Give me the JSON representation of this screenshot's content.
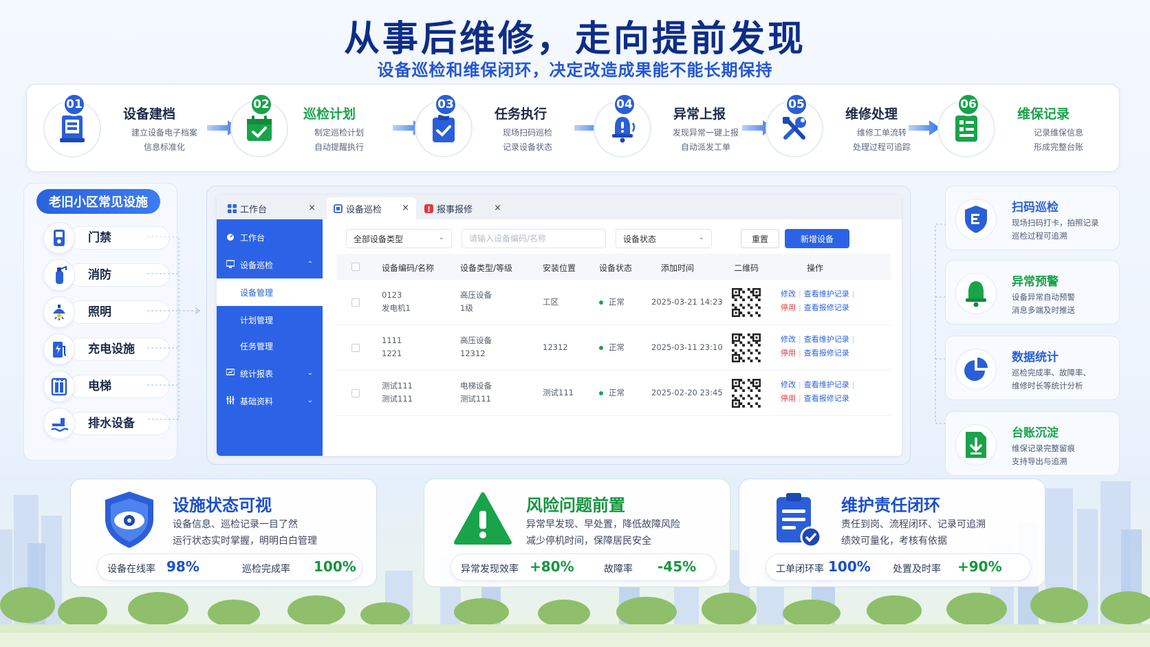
{
  "hero": {
    "title": "从事后维修，走向提前发现",
    "subtitle": "设备巡检和维保闭环，决定改造成果能不能长期保持"
  },
  "steps": [
    {
      "num": "01",
      "title": "设备建档",
      "desc1": "建立设备电子档案",
      "desc2": "信息标准化",
      "color": "#2a5fd8",
      "icon": "device-file-icon"
    },
    {
      "num": "02",
      "title": "巡检计划",
      "desc1": "制定巡检计划",
      "desc2": "自动提醒执行",
      "color": "#19a34a",
      "icon": "calendar-check-icon"
    },
    {
      "num": "03",
      "title": "任务执行",
      "desc1": "现场扫码巡检",
      "desc2": "记录设备状态",
      "color": "#2a5fd8",
      "icon": "clipboard-check-icon"
    },
    {
      "num": "04",
      "title": "异常上报",
      "desc1": "发现异常一键上报",
      "desc2": "自动派发工单",
      "color": "#2a5fd8",
      "icon": "alarm-bell-icon"
    },
    {
      "num": "05",
      "title": "维修处理",
      "desc1": "维修工单流转",
      "desc2": "处理过程可追踪",
      "color": "#2a5fd8",
      "icon": "repair-tools-icon"
    },
    {
      "num": "06",
      "title": "维保记录",
      "desc1": "记录维保信息",
      "desc2": "形成完整台账",
      "color": "#19a34a",
      "icon": "record-book-icon"
    }
  ],
  "facilities": {
    "heading": "老旧小区常见设施",
    "items": [
      {
        "label": "门禁",
        "icon": "access-control-icon"
      },
      {
        "label": "消防",
        "icon": "fire-extinguisher-icon"
      },
      {
        "label": "照明",
        "icon": "lighting-icon"
      },
      {
        "label": "充电设施",
        "icon": "charging-station-icon"
      },
      {
        "label": "电梯",
        "icon": "elevator-icon"
      },
      {
        "label": "排水设备",
        "icon": "drainage-icon"
      }
    ]
  },
  "app": {
    "tabs": [
      {
        "label": "工作台",
        "close": "×"
      },
      {
        "label": "设备巡检",
        "close": "×"
      },
      {
        "label": "报事报修",
        "close": "×"
      }
    ],
    "nav": {
      "workbench": "工作台",
      "inspection": "设备巡检",
      "device_mgmt": "设备管理",
      "plan_mgmt": "计划管理",
      "task_mgmt": "任务管理",
      "reports": "统计报表",
      "basic_data": "基础资料"
    },
    "filters": {
      "type_select": "全部设备类型",
      "search_placeholder": "请输入设备编码/名称",
      "status_select": "设备状态",
      "reset": "重置",
      "add": "新增设备"
    },
    "columns": [
      "设备编码/名称",
      "设备类型/等级",
      "安装位置",
      "设备状态",
      "添加时间",
      "二维码",
      "操作"
    ],
    "rows": [
      {
        "code": "0123",
        "name": "发电机1",
        "type": "高压设备",
        "level": "1级",
        "location": "工区",
        "status": "正常",
        "time": "2025-03-21 14:23"
      },
      {
        "code": "1111",
        "name": "1221",
        "type": "高压设备",
        "level": "12312",
        "location": "12312",
        "status": "正常",
        "time": "2025-03-11 23:10"
      },
      {
        "code": "测试111",
        "name": "测试111",
        "type": "电梯设备",
        "level": "测试111",
        "location": "测试111",
        "status": "正常",
        "time": "2025-02-20 23:45"
      }
    ],
    "ops": {
      "edit": "修改",
      "maint_record": "查看维护记录",
      "disable": "停用",
      "repair_record": "查看报修记录",
      "sep": "|"
    }
  },
  "features": [
    {
      "title": "扫码巡检",
      "desc1": "现场扫码打卡，拍照记录",
      "desc2": "巡检过程可追溯",
      "icon": "scan-shield-icon",
      "color": "#2a5fd8"
    },
    {
      "title": "异常预警",
      "desc1": "设备异常自动预警",
      "desc2": "消息多端及时推送",
      "icon": "warning-bell-icon",
      "color": "#19a34a"
    },
    {
      "title": "数据统计",
      "desc1": "巡检完成率、故障率、",
      "desc2": "维修时长等统计分析",
      "icon": "pie-chart-icon",
      "color": "#2a5fd8"
    },
    {
      "title": "台账沉淀",
      "desc1": "维保记录完整留痕",
      "desc2": "支持导出与追溯",
      "icon": "download-file-icon",
      "color": "#19a34a"
    }
  ],
  "cards": [
    {
      "title": "设施状态可视",
      "desc1": "设备信息、巡检记录一目了然",
      "desc2": "运行状态实时掌握，明明白白管理",
      "s1_label": "设备在线率",
      "s1_value": "98%",
      "s2_label": "巡检完成率",
      "s2_value": "100%",
      "color": "#1c4fd0",
      "icon": "eye-shield-icon"
    },
    {
      "title": "风险问题前置",
      "desc1": "异常早发现、早处置，降低故障风险",
      "desc2": "减少停机时间，保障居民安全",
      "s1_label": "异常发现效率",
      "s1_value": "+80%",
      "s2_label": "故障率",
      "s2_value": "-45%",
      "color": "#15963f",
      "icon": "warning-triangle-icon"
    },
    {
      "title": "维护责任闭环",
      "desc1": "责任到岗、流程闭环、记录可追溯",
      "desc2": "绩效可量化，考核有依据",
      "s1_label": "工单闭环率",
      "s1_value": "100%",
      "s2_label": "处置及时率",
      "s2_value": "+90%",
      "color": "#1c4fd0",
      "icon": "task-clipboard-icon"
    }
  ],
  "colors": {
    "primary": "#2c63e6",
    "green": "#19a34a",
    "title": "#0e2d87",
    "danger": "#e0393e"
  }
}
